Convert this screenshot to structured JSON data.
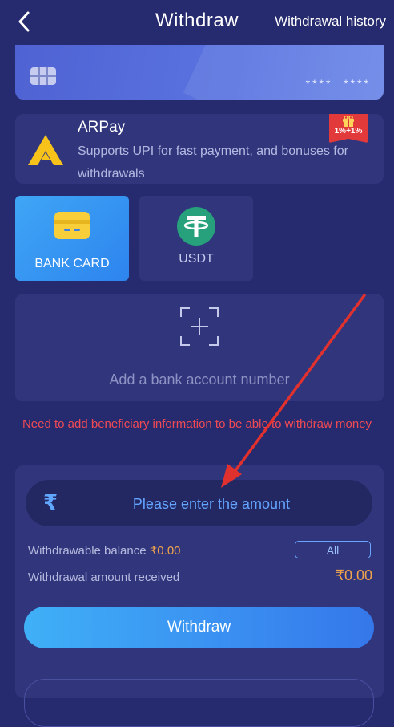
{
  "header": {
    "title": "Withdraw",
    "history_label": "Withdrawal history"
  },
  "card": {
    "masked_number": "****  ****"
  },
  "arpay": {
    "name": "ARPay",
    "description": "Supports UPI for fast payment, and bonuses for withdrawals",
    "promo_badge": "1%+1%"
  },
  "methods": [
    {
      "label": "BANK CARD",
      "icon": "bank-card-icon",
      "selected": true
    },
    {
      "label": "USDT",
      "icon": "usdt-icon",
      "selected": false
    }
  ],
  "add_account": {
    "text": "Add a bank account number"
  },
  "warning": "Need to add beneficiary information to be able to withdraw money",
  "amount": {
    "currency_symbol": "₹",
    "placeholder": "Please enter the amount",
    "value": ""
  },
  "balance": {
    "label": "Withdrawable balance",
    "value": "₹0.00",
    "all_label": "All"
  },
  "received": {
    "label": "Withdrawal amount received",
    "value": "₹0.00"
  },
  "withdraw_button": "Withdraw",
  "colors": {
    "background": "#262a6e",
    "panel": "#31367c",
    "accent_blue": "#3a8ef1",
    "warning_red": "#f04a55",
    "amount_orange": "#f0a34a",
    "annotation_arrow": "#e0312f"
  }
}
